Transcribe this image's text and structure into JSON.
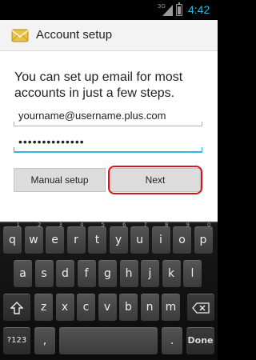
{
  "status_bar": {
    "network": "3G",
    "time": "4:42",
    "battery_level": 0.7,
    "time_color": "#33b5e5"
  },
  "action_bar": {
    "title": "Account setup",
    "icon": "email-envelope-icon"
  },
  "content": {
    "instructions": "You can set up email for most accounts in just a few steps.",
    "email_value": "yourname@username.plus.com",
    "password_value": "••••••••••••••",
    "manual_setup_label": "Manual setup",
    "next_label": "Next",
    "highlight_color": "#d8141c"
  },
  "keyboard": {
    "row1": [
      {
        "label": "q",
        "hint": "1"
      },
      {
        "label": "w",
        "hint": "2"
      },
      {
        "label": "e",
        "hint": "3"
      },
      {
        "label": "r",
        "hint": "4"
      },
      {
        "label": "t",
        "hint": "5"
      },
      {
        "label": "y",
        "hint": "6"
      },
      {
        "label": "u",
        "hint": "7"
      },
      {
        "label": "i",
        "hint": "8"
      },
      {
        "label": "o",
        "hint": "9"
      },
      {
        "label": "p",
        "hint": "0"
      }
    ],
    "row2": [
      "a",
      "s",
      "d",
      "f",
      "g",
      "h",
      "j",
      "k",
      "l"
    ],
    "row3": [
      "z",
      "x",
      "c",
      "v",
      "b",
      "n",
      "m"
    ],
    "shift_icon": "shift-arrow-icon",
    "backspace_icon": "backspace-icon",
    "symbols_label": "?123",
    "comma_label": ",",
    "period_label": ".",
    "done_label": "Done"
  }
}
